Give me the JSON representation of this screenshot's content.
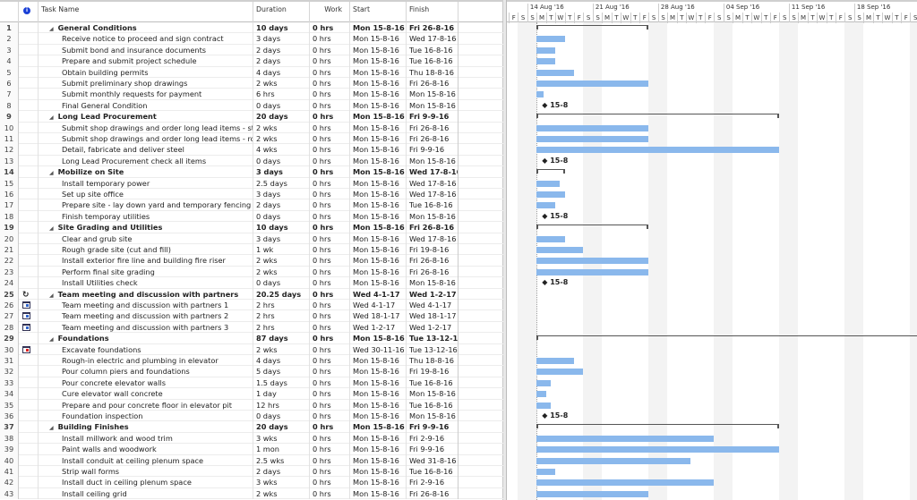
{
  "columns": {
    "info_icon": "info-icon",
    "task_name": "Task Name",
    "duration": "Duration",
    "work": "Work",
    "start": "Start",
    "finish": "Finish"
  },
  "timescale": {
    "weeks": [
      "14 Aug '16",
      "21 Aug '16",
      "28 Aug '16",
      "04 Sep '16",
      "11 Sep '16",
      "18 Sep '16"
    ],
    "day_letters": [
      "F",
      "S",
      "S",
      "M",
      "T",
      "W",
      "T",
      "F",
      "S",
      "S",
      "M",
      "T",
      "W",
      "T",
      "F",
      "S",
      "S",
      "M",
      "T",
      "W",
      "T",
      "F",
      "S",
      "S",
      "M",
      "T",
      "W",
      "T",
      "F",
      "S",
      "S",
      "M",
      "T",
      "W",
      "T",
      "F",
      "S",
      "S",
      "M",
      "T",
      "W",
      "T",
      "F",
      "S",
      "S"
    ]
  },
  "colors": {
    "bar": "#8ab8ec",
    "summary": "#555555",
    "weekend": "#f3f3f3"
  },
  "tasks": [
    {
      "id": "1",
      "name": "General Conditions",
      "summary": true,
      "duration": "10 days",
      "work": "0 hrs",
      "start": "Mon 15-8-16",
      "finish": "Fri 26-8-16"
    },
    {
      "id": "2",
      "name": "Receive notice to proceed and sign contract",
      "duration": "3 days",
      "work": "0 hrs",
      "start": "Mon 15-8-16",
      "finish": "Wed 17-8-16"
    },
    {
      "id": "3",
      "name": "Submit bond and insurance documents",
      "duration": "2 days",
      "work": "0 hrs",
      "start": "Mon 15-8-16",
      "finish": "Tue 16-8-16"
    },
    {
      "id": "4",
      "name": "Prepare and submit project schedule",
      "duration": "2 days",
      "work": "0 hrs",
      "start": "Mon 15-8-16",
      "finish": "Tue 16-8-16"
    },
    {
      "id": "5",
      "name": "Obtain building permits",
      "duration": "4 days",
      "work": "0 hrs",
      "start": "Mon 15-8-16",
      "finish": "Thu 18-8-16"
    },
    {
      "id": "6",
      "name": "Submit preliminary shop drawings",
      "duration": "2 wks",
      "work": "0 hrs",
      "start": "Mon 15-8-16",
      "finish": "Fri 26-8-16"
    },
    {
      "id": "7",
      "name": "Submit monthly requests for payment",
      "duration": "6 hrs",
      "work": "0 hrs",
      "start": "Mon 15-8-16",
      "finish": "Mon 15-8-16"
    },
    {
      "id": "8",
      "name": "Final General Condition",
      "duration": "0 days",
      "work": "0 hrs",
      "start": "Mon 15-8-16",
      "finish": "Mon 15-8-16",
      "milestone_label": "15-8"
    },
    {
      "id": "9",
      "name": "Long Lead Procurement",
      "summary": true,
      "duration": "20 days",
      "work": "0 hrs",
      "start": "Mon 15-8-16",
      "finish": "Fri 9-9-16"
    },
    {
      "id": "10",
      "name": "Submit shop drawings and order long lead items - steel",
      "duration": "2 wks",
      "work": "0 hrs",
      "start": "Mon 15-8-16",
      "finish": "Fri 26-8-16"
    },
    {
      "id": "11",
      "name": "Submit shop drawings and order long lead items - roofing",
      "duration": "2 wks",
      "work": "0 hrs",
      "start": "Mon 15-8-16",
      "finish": "Fri 26-8-16"
    },
    {
      "id": "12",
      "name": "Detail, fabricate and deliver steel",
      "duration": "4 wks",
      "work": "0 hrs",
      "start": "Mon 15-8-16",
      "finish": "Fri 9-9-16"
    },
    {
      "id": "13",
      "name": "Long Lead Procurement check all items",
      "duration": "0 days",
      "work": "0 hrs",
      "start": "Mon 15-8-16",
      "finish": "Mon 15-8-16",
      "milestone_label": "15-8"
    },
    {
      "id": "14",
      "name": "Mobilize on Site",
      "summary": true,
      "duration": "3 days",
      "work": "0 hrs",
      "start": "Mon 15-8-16",
      "finish": "Wed 17-8-16"
    },
    {
      "id": "15",
      "name": "Install temporary power",
      "duration": "2.5 days",
      "work": "0 hrs",
      "start": "Mon 15-8-16",
      "finish": "Wed 17-8-16"
    },
    {
      "id": "16",
      "name": "Set up site office",
      "duration": "3 days",
      "work": "0 hrs",
      "start": "Mon 15-8-16",
      "finish": "Wed 17-8-16"
    },
    {
      "id": "17",
      "name": "Prepare site - lay down yard and temporary fencing",
      "duration": "2 days",
      "work": "0 hrs",
      "start": "Mon 15-8-16",
      "finish": "Tue 16-8-16"
    },
    {
      "id": "18",
      "name": "Finish temporay utilities",
      "duration": "0 days",
      "work": "0 hrs",
      "start": "Mon 15-8-16",
      "finish": "Mon 15-8-16",
      "milestone_label": "15-8"
    },
    {
      "id": "19",
      "name": "Site Grading and Utilities",
      "summary": true,
      "duration": "10 days",
      "work": "0 hrs",
      "start": "Mon 15-8-16",
      "finish": "Fri 26-8-16"
    },
    {
      "id": "20",
      "name": "Clear and grub site",
      "duration": "3 days",
      "work": "0 hrs",
      "start": "Mon 15-8-16",
      "finish": "Wed 17-8-16"
    },
    {
      "id": "21",
      "name": "Rough grade site (cut and fill)",
      "duration": "1 wk",
      "work": "0 hrs",
      "start": "Mon 15-8-16",
      "finish": "Fri 19-8-16"
    },
    {
      "id": "22",
      "name": "Install exterior fire line and building fire riser",
      "duration": "2 wks",
      "work": "0 hrs",
      "start": "Mon 15-8-16",
      "finish": "Fri 26-8-16"
    },
    {
      "id": "23",
      "name": "Perform final site grading",
      "duration": "2 wks",
      "work": "0 hrs",
      "start": "Mon 15-8-16",
      "finish": "Fri 26-8-16"
    },
    {
      "id": "24",
      "name": "Install Utilities check",
      "duration": "0 days",
      "work": "0 hrs",
      "start": "Mon 15-8-16",
      "finish": "Mon 15-8-16",
      "milestone_label": "15-8"
    },
    {
      "id": "25",
      "name": "Team meeting and discussion with partners",
      "summary": true,
      "indicator": "recurring-icon",
      "duration": "20.25 days",
      "work": "0 hrs",
      "start": "Wed 4-1-17",
      "finish": "Wed 1-2-17"
    },
    {
      "id": "26",
      "name": "Team meeting and discussion with partners 1",
      "indicator": "calendar-icon",
      "duration": "2 hrs",
      "work": "0 hrs",
      "start": "Wed 4-1-17",
      "finish": "Wed 4-1-17"
    },
    {
      "id": "27",
      "name": "Team meeting and discussion with partners 2",
      "indicator": "calendar-icon",
      "duration": "2 hrs",
      "work": "0 hrs",
      "start": "Wed 18-1-17",
      "finish": "Wed 18-1-17"
    },
    {
      "id": "28",
      "name": "Team meeting and discussion with partners 3",
      "indicator": "calendar-icon",
      "duration": "2 hrs",
      "work": "0 hrs",
      "start": "Wed 1-2-17",
      "finish": "Wed 1-2-17"
    },
    {
      "id": "29",
      "name": "Foundations",
      "summary": true,
      "duration": "87 days",
      "work": "0 hrs",
      "start": "Mon 15-8-16",
      "finish": "Tue 13-12-16"
    },
    {
      "id": "30",
      "name": "Excavate foundations",
      "indicator": "constraint-icon",
      "duration": "2 wks",
      "work": "0 hrs",
      "start": "Wed 30-11-16",
      "finish": "Tue 13-12-16"
    },
    {
      "id": "31",
      "name": "Rough-in electric and plumbing in elevator",
      "duration": "4 days",
      "work": "0 hrs",
      "start": "Mon 15-8-16",
      "finish": "Thu 18-8-16"
    },
    {
      "id": "32",
      "name": "Pour column piers and foundations",
      "duration": "5 days",
      "work": "0 hrs",
      "start": "Mon 15-8-16",
      "finish": "Fri 19-8-16"
    },
    {
      "id": "33",
      "name": "Pour concrete elevator walls",
      "duration": "1.5 days",
      "work": "0 hrs",
      "start": "Mon 15-8-16",
      "finish": "Tue 16-8-16"
    },
    {
      "id": "34",
      "name": "Cure elevator wall concrete",
      "duration": "1 day",
      "work": "0 hrs",
      "start": "Mon 15-8-16",
      "finish": "Mon 15-8-16"
    },
    {
      "id": "35",
      "name": "Prepare and pour concrete floor in elevator pit",
      "duration": "12 hrs",
      "work": "0 hrs",
      "start": "Mon 15-8-16",
      "finish": "Tue 16-8-16"
    },
    {
      "id": "36",
      "name": "Foundation inspection",
      "duration": "0 days",
      "work": "0 hrs",
      "start": "Mon 15-8-16",
      "finish": "Mon 15-8-16",
      "milestone_label": "15-8"
    },
    {
      "id": "37",
      "name": "Building Finishes",
      "summary": true,
      "duration": "20 days",
      "work": "0 hrs",
      "start": "Mon 15-8-16",
      "finish": "Fri 9-9-16"
    },
    {
      "id": "38",
      "name": "Install millwork and wood trim",
      "duration": "3 wks",
      "work": "0 hrs",
      "start": "Mon 15-8-16",
      "finish": "Fri 2-9-16"
    },
    {
      "id": "39",
      "name": "Paint walls and woodwork",
      "duration": "1 mon",
      "work": "0 hrs",
      "start": "Mon 15-8-16",
      "finish": "Fri 9-9-16"
    },
    {
      "id": "40",
      "name": "Install conduit at ceiling plenum space",
      "duration": "2.5 wks",
      "work": "0 hrs",
      "start": "Mon 15-8-16",
      "finish": "Wed 31-8-16"
    },
    {
      "id": "41",
      "name": "Strip wall forms",
      "duration": "2 days",
      "work": "0 hrs",
      "start": "Mon 15-8-16",
      "finish": "Tue 16-8-16"
    },
    {
      "id": "42",
      "name": "Install duct in ceiling plenum space",
      "duration": "3 wks",
      "work": "0 hrs",
      "start": "Mon 15-8-16",
      "finish": "Fri 2-9-16"
    },
    {
      "id": "43",
      "name": "Install ceiling grid",
      "duration": "2 wks",
      "work": "0 hrs",
      "start": "Mon 15-8-16",
      "finish": "Fri 26-8-16"
    }
  ]
}
